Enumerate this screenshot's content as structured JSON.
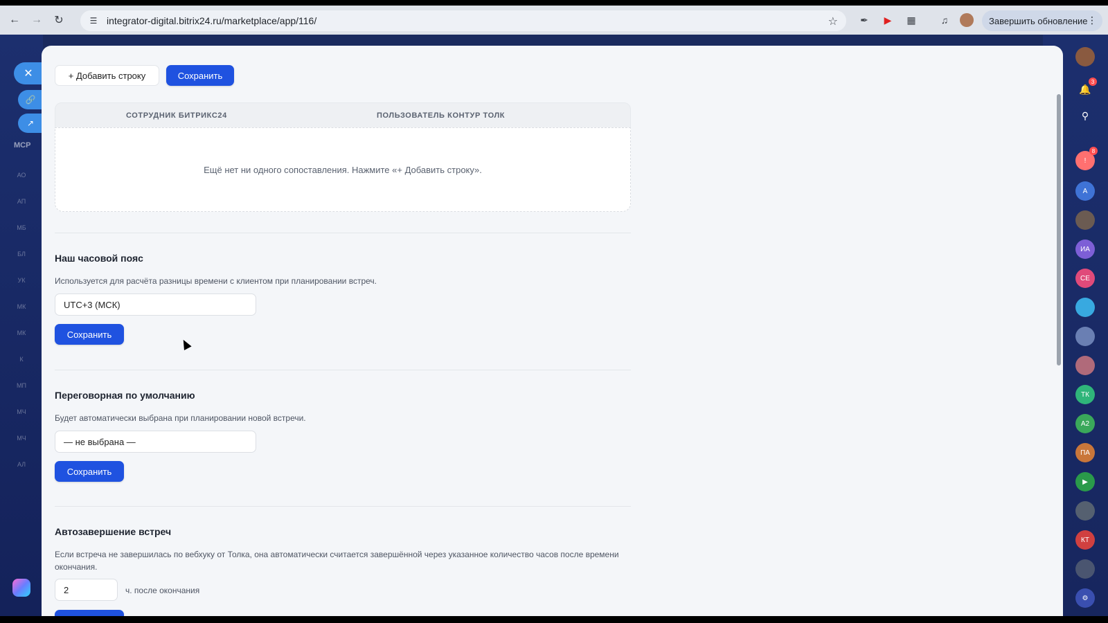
{
  "browser": {
    "url": "integrator-digital.bitrix24.ru/marketplace/app/116/",
    "update_button": "Завершить обновление"
  },
  "left_rail": {
    "items": [
      "MCP",
      "АО",
      "АП",
      "МБ",
      "БЛ",
      "УК",
      "МК",
      "МК",
      "К",
      "МП",
      "МЧ",
      "МЧ",
      "АЛ"
    ]
  },
  "right_rail": {
    "notifications_badge": "3",
    "alerts_badge": "8",
    "avatars": [
      "А",
      "ИА",
      "СЕ",
      "ТК",
      "А2",
      "ПА",
      "КТ"
    ]
  },
  "toolbar": {
    "add_row_label": "+ Добавить строку",
    "save_label": "Сохранить"
  },
  "mapping_table": {
    "columns": [
      "СОТРУДНИК БИТРИКС24",
      "ПОЛЬЗОВАТЕЛЬ КОНТУР ТОЛК"
    ],
    "empty_text": "Ещё нет ни одного сопоставления. Нажмите «+ Добавить строку»."
  },
  "timezone": {
    "title": "Наш часовой пояс",
    "description": "Используется для расчёта разницы времени с клиентом при планировании встреч.",
    "value": "UTC+3 (МСК)",
    "save_label": "Сохранить"
  },
  "room": {
    "title": "Переговорная по умолчанию",
    "description": "Будет автоматически выбрана при планировании новой встречи.",
    "value": "— не выбрана —",
    "save_label": "Сохранить"
  },
  "autocomplete": {
    "title": "Автозавершение встреч",
    "description": "Если встреча не завершилась по вебхуку от Толка, она автоматически считается завершённой через указанное количество часов после времени окончания.",
    "value": "2",
    "suffix": "ч. после окончания"
  }
}
